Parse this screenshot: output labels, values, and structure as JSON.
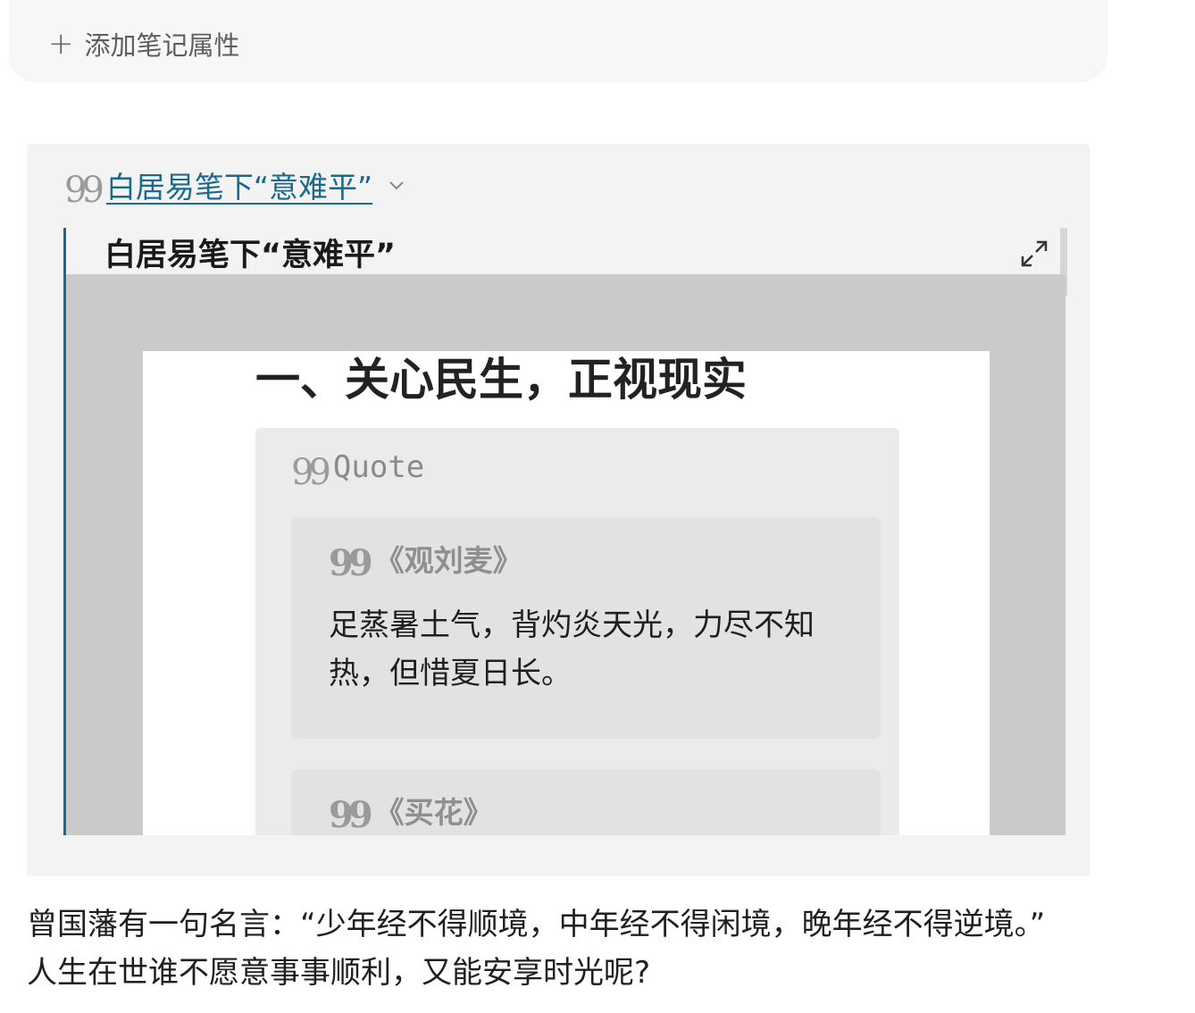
{
  "properties": {
    "add_label": "添加笔记属性",
    "plus_icon": "plus-icon"
  },
  "callout": {
    "title": "白居易笔下“意难平”",
    "icon": "quote-icon",
    "link_color": "#1b6a8c"
  },
  "embed": {
    "title": "白居易笔下“意难平”",
    "preview": {
      "heading": "一、关心民生，正视现实",
      "quote_label": "Quote",
      "quotes": [
        {
          "title": "《观刘麦》",
          "body": "足蒸暑土气，背灼炎天光，力尽不知热，但惜夏日长。"
        },
        {
          "title": "《买花》",
          "body": ""
        }
      ]
    }
  },
  "paragraph": {
    "line1": "曾国藩有一句名言：“少年经不得顺境，中年经不得闲境，晚年经不得逆境。”",
    "line2": "人生在世谁不愿意事事顺利，又能安享时光呢?"
  }
}
